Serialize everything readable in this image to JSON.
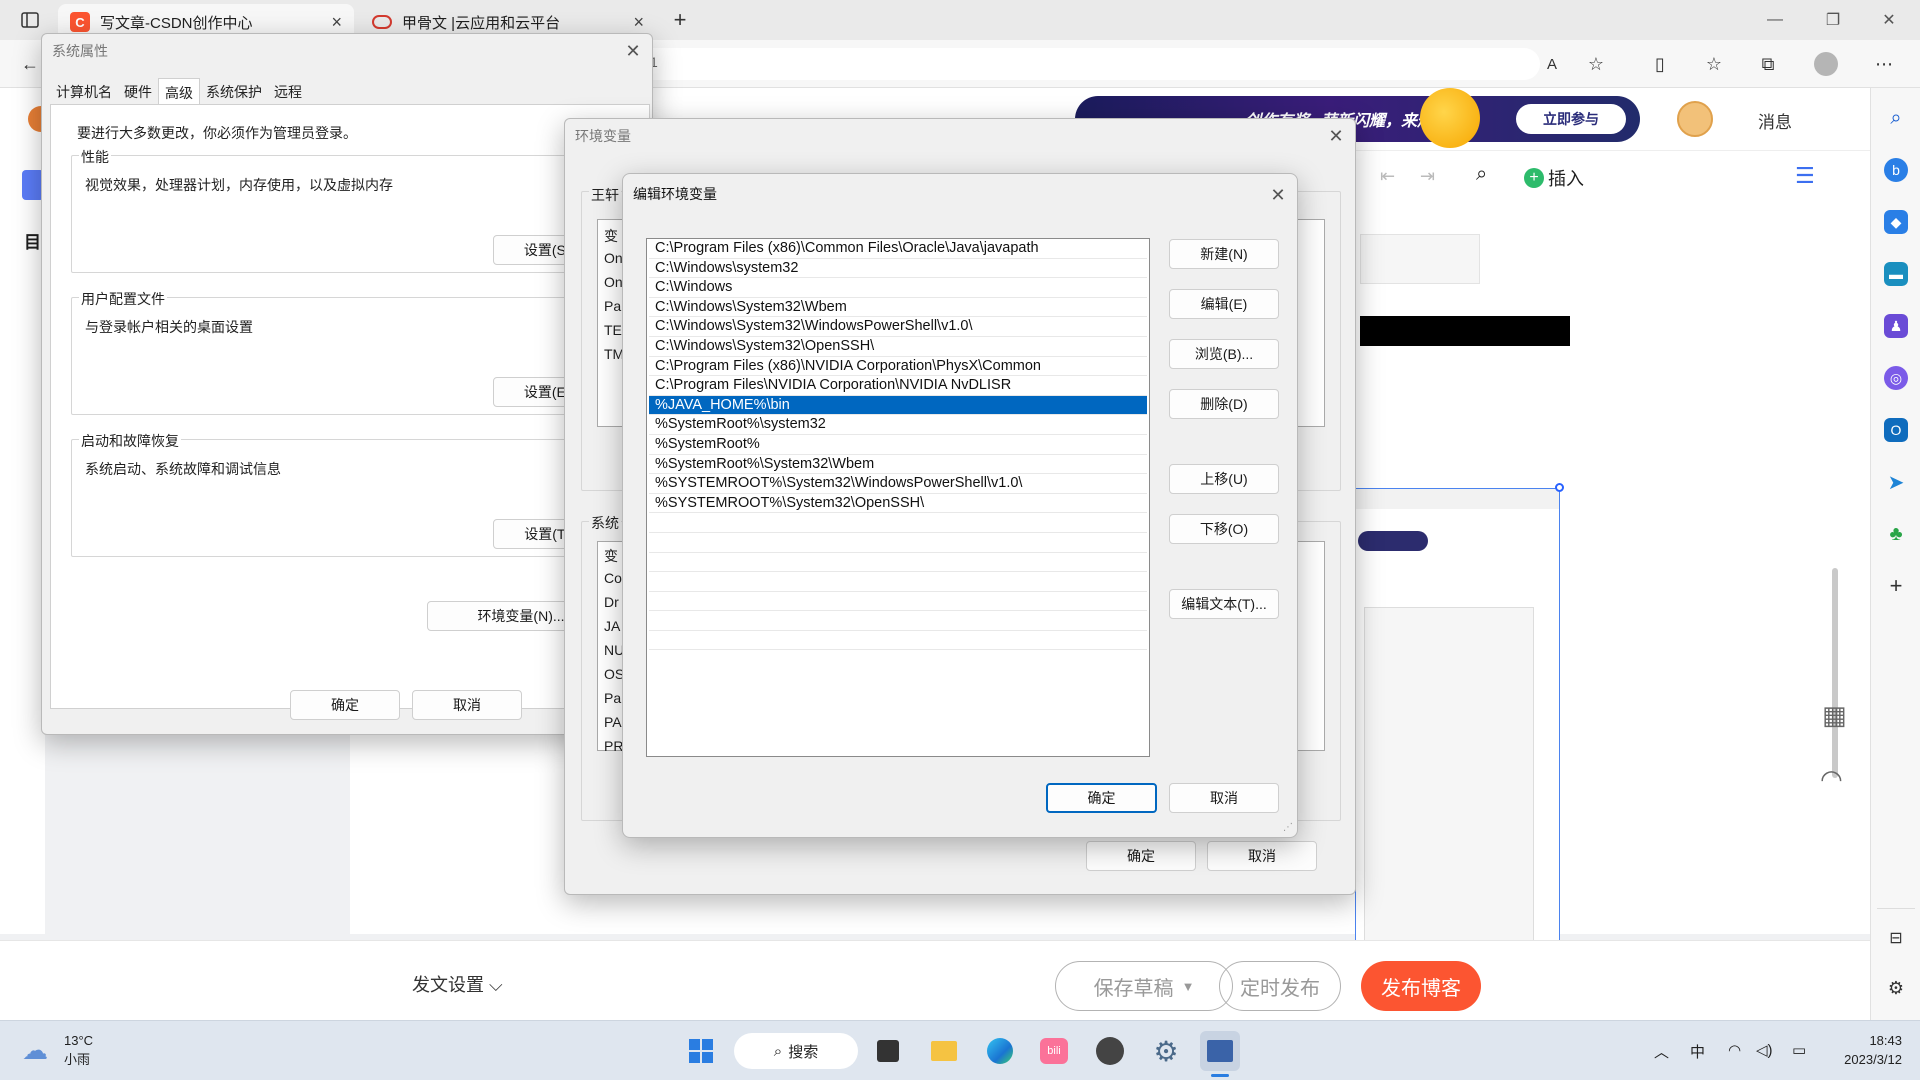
{
  "browser": {
    "tabs": [
      {
        "title": "写文章-CSDN创作中心",
        "favicon": "C",
        "color": "#fc5531"
      },
      {
        "title": "甲骨文 |云应用和云平台",
        "favicon": "O",
        "color": "#d43a2f"
      }
    ],
    "address_hint": "1",
    "sidebar_icons": [
      "search-icon",
      "bing-icon",
      "tag-icon",
      "toolbox-icon",
      "games-icon",
      "office-icon",
      "outlook-icon",
      "send-icon",
      "tree-icon",
      "plus-icon",
      "sidebar-icon",
      "settings-icon"
    ]
  },
  "csdn": {
    "banner_text1": "创作有奖",
    "banner_text2": "萌新闪耀，来爆！",
    "banner_join": "立即参与",
    "messages": "消息",
    "insert": "插入",
    "left_label": "目",
    "footer": {
      "settings": "发文设置",
      "save_draft": "保存草稿",
      "schedule": "定时发布",
      "publish": "发布博客"
    }
  },
  "sysprops": {
    "title": "系统属性",
    "tabs": [
      "计算机名",
      "硬件",
      "高级",
      "系统保护",
      "远程"
    ],
    "active_tab": "高级",
    "admin_note": "要进行大多数更改，你必须作为管理员登录。",
    "perf_title": "性能",
    "perf_desc": "视觉效果，处理器计划，内存使用，以及虚拟内存",
    "perf_btn": "设置(S)...",
    "profile_title": "用户配置文件",
    "profile_desc": "与登录帐户相关的桌面设置",
    "profile_btn": "设置(E)...",
    "startup_title": "启动和故障恢复",
    "startup_desc": "系统启动、系统故障和调试信息",
    "startup_btn": "设置(T)...",
    "env_btn": "环境变量(N)...",
    "ok": "确定",
    "cancel": "取消"
  },
  "envvars": {
    "title": "环境变量",
    "user_group": "王轩",
    "user_header": "变",
    "user_rows": [
      "On",
      "On",
      "Pa",
      "TE",
      "TM"
    ],
    "sys_group": "系统",
    "sys_header": "变",
    "sys_rows": [
      "Co",
      "Dr",
      "JA",
      "NU",
      "OS",
      "Pa",
      "PA",
      "PR"
    ],
    "ok": "确定",
    "cancel": "取消"
  },
  "editenv": {
    "title": "编辑环境变量",
    "entries": [
      "C:\\Program Files (x86)\\Common Files\\Oracle\\Java\\javapath",
      "C:\\Windows\\system32",
      "C:\\Windows",
      "C:\\Windows\\System32\\Wbem",
      "C:\\Windows\\System32\\WindowsPowerShell\\v1.0\\",
      "C:\\Windows\\System32\\OpenSSH\\",
      "C:\\Program Files (x86)\\NVIDIA Corporation\\PhysX\\Common",
      "C:\\Program Files\\NVIDIA Corporation\\NVIDIA NvDLISR",
      "%JAVA_HOME%\\bin",
      "%SystemRoot%\\system32",
      "%SystemRoot%",
      "%SystemRoot%\\System32\\Wbem",
      "%SYSTEMROOT%\\System32\\WindowsPowerShell\\v1.0\\",
      "%SYSTEMROOT%\\System32\\OpenSSH\\"
    ],
    "selected_entry": "%JAVA_HOME%\\bin",
    "buttons": {
      "new": "新建(N)",
      "edit": "编辑(E)",
      "browse": "浏览(B)...",
      "delete": "删除(D)",
      "up": "上移(U)",
      "down": "下移(O)",
      "edit_text": "编辑文本(T)..."
    },
    "ok": "确定",
    "cancel": "取消"
  },
  "taskbar": {
    "weather_temp": "13°C",
    "weather_desc": "小雨",
    "search": "搜索",
    "ime": "中",
    "time": "18:43",
    "date": "2023/3/12"
  }
}
